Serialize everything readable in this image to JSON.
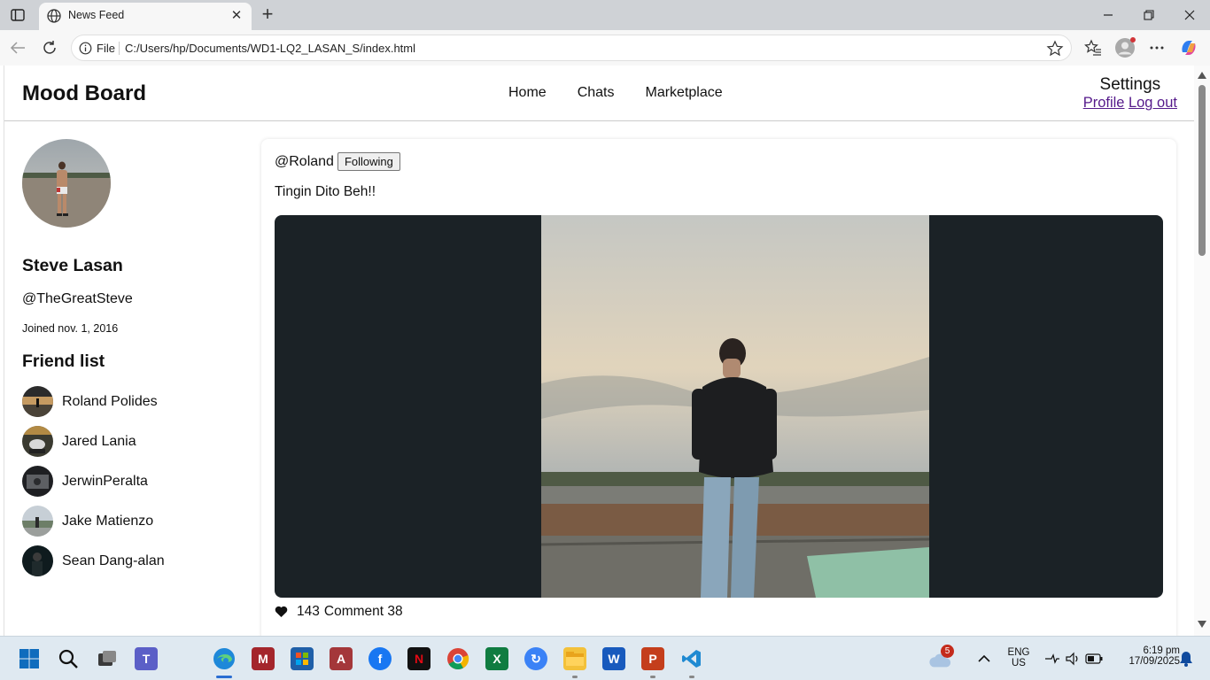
{
  "browser": {
    "tab_title": "News Feed",
    "file_label": "File",
    "url": "C:/Users/hp/Documents/WD1-LQ2_LASAN_S/index.html"
  },
  "site": {
    "brand": "Mood Board",
    "nav": [
      "Home",
      "Chats",
      "Marketplace"
    ],
    "settings_title": "Settings",
    "profile_link": "Profile",
    "logout_link": "Log out"
  },
  "profile": {
    "name": "Steve Lasan",
    "handle": "@TheGreatSteve",
    "joined": "Joined nov. 1, 2016",
    "friends_title": "Friend list",
    "friends": [
      {
        "name": "Roland Polides"
      },
      {
        "name": "Jared Lania"
      },
      {
        "name": "JerwinPeralta"
      },
      {
        "name": "Jake Matienzo"
      },
      {
        "name": "Sean Dang-alan"
      }
    ]
  },
  "post": {
    "user": "@Roland",
    "follow_label": "Following",
    "text": "Tingin Dito Beh!!",
    "likes": "143",
    "comments": "Comment 38"
  },
  "taskbar": {
    "notification_count": "5",
    "language": "ENG",
    "region": "US",
    "time": "6:19 pm",
    "date": "17/09/2025"
  },
  "colors": {
    "link": "#551a8b",
    "media_background": "#1b2226",
    "taskbar": "#dfe9f1"
  }
}
